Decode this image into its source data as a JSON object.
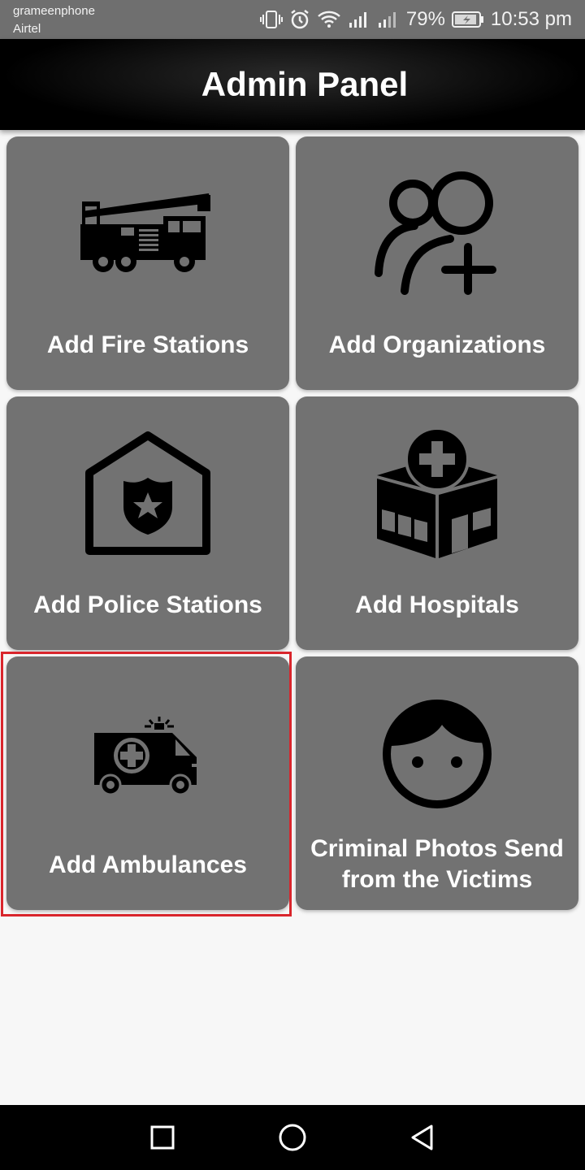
{
  "status_bar": {
    "carrier_1": "grameenphone",
    "carrier_2": "Airtel",
    "battery": "79%",
    "time": "10:53 pm",
    "icons": [
      "vibrate-icon",
      "alarm-icon",
      "wifi-icon",
      "signal-icon",
      "signal-icon",
      "battery-icon"
    ]
  },
  "toolbar": {
    "title": "Admin Panel"
  },
  "tiles": [
    {
      "label": "Add Fire Stations",
      "icon": "fire-truck-icon"
    },
    {
      "label": "Add Organizations",
      "icon": "add-user-group-icon"
    },
    {
      "label": "Add Police Stations",
      "icon": "police-station-icon"
    },
    {
      "label": "Add Hospitals",
      "icon": "hospital-icon"
    },
    {
      "label": "Add Ambulances",
      "icon": "ambulance-icon"
    },
    {
      "label": "Criminal Photos Send from the Victims",
      "icon": "face-icon"
    }
  ],
  "nav_bar": {
    "icons": [
      "recent-apps-icon",
      "home-icon",
      "back-icon"
    ]
  },
  "colors": {
    "tile_bg": "#727272",
    "highlight": "#d9252c",
    "toolbar_bg": "#000000"
  }
}
